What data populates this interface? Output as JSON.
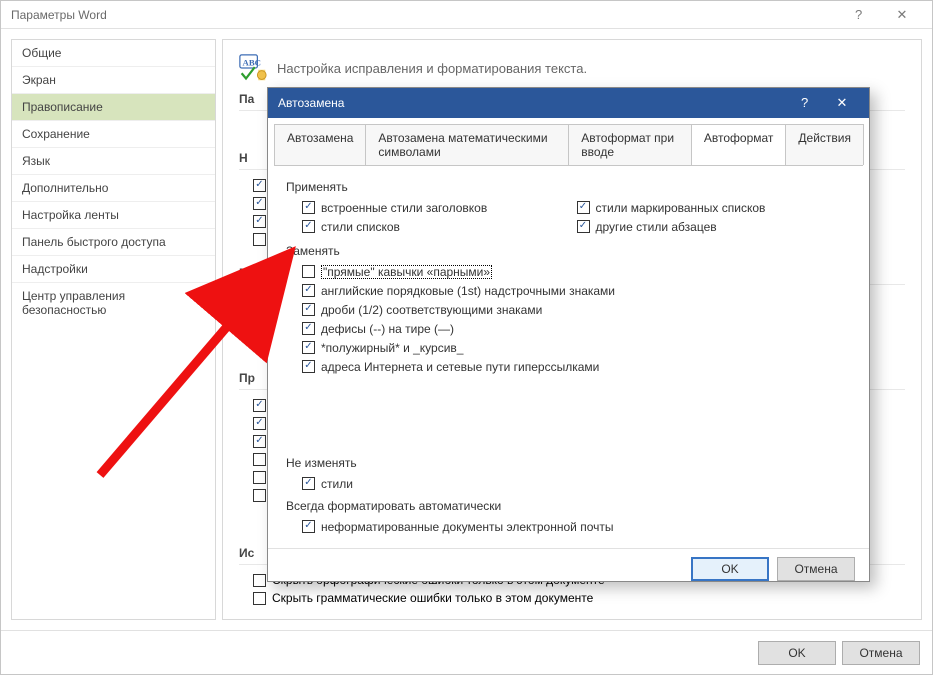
{
  "outer": {
    "title": "Параметры Word",
    "ok": "OK",
    "cancel": "Отмена"
  },
  "sidebar": {
    "items": [
      {
        "label": "Общие"
      },
      {
        "label": "Экран"
      },
      {
        "label": "Правописание"
      },
      {
        "label": "Сохранение"
      },
      {
        "label": "Язык"
      },
      {
        "label": "Дополнительно"
      },
      {
        "label": "Настройка ленты"
      },
      {
        "label": "Панель быстрого доступа"
      },
      {
        "label": "Надстройки"
      },
      {
        "label": "Центр управления безопасностью"
      }
    ],
    "selected_index": 2
  },
  "main": {
    "heading": "Настройка исправления и форматирования текста.",
    "section_pa": "Па",
    "section_n": "Н",
    "section_pr": "Пр",
    "section_pr2": "Пр",
    "section_is": "Ис",
    "hide_spelling": "Скрыть орфографические ошибки только в этом документе",
    "hide_grammar": "Скрыть грамматические ошибки только в этом документе"
  },
  "inner": {
    "title": "Автозамена",
    "ok": "OK",
    "cancel": "Отмена",
    "tabs": [
      {
        "label": "Автозамена"
      },
      {
        "label": "Автозамена математическими символами"
      },
      {
        "label": "Автоформат при вводе"
      },
      {
        "label": "Автоформат"
      },
      {
        "label": "Действия"
      }
    ],
    "active_tab": 3,
    "group_apply": "Применять",
    "apply_items_left": [
      {
        "label": "встроенные стили заголовков",
        "checked": true
      },
      {
        "label": "стили списков",
        "checked": true
      }
    ],
    "apply_items_right": [
      {
        "label": "стили маркированных списков",
        "checked": true
      },
      {
        "label": "другие стили абзацев",
        "checked": true
      }
    ],
    "group_replace": "Заменять",
    "replace_items": [
      {
        "label": "\"прямые\" кавычки «парными»",
        "checked": false,
        "focused": true
      },
      {
        "label": "английские порядковые (1st) надстрочными знаками",
        "checked": true
      },
      {
        "label": "дроби (1/2) соответствующими знаками",
        "checked": true
      },
      {
        "label": "дефисы (--) на тире (—)",
        "checked": true
      },
      {
        "label": "*полужирный* и _курсив_",
        "checked": true
      },
      {
        "label": "адреса Интернета и сетевые пути гиперссылками",
        "checked": true
      }
    ],
    "group_preserve": "Не изменять",
    "preserve_items": [
      {
        "label": "стили",
        "checked": true
      }
    ],
    "group_always": "Всегда форматировать автоматически",
    "always_items": [
      {
        "label": "неформатированные документы электронной почты",
        "checked": true
      }
    ]
  }
}
